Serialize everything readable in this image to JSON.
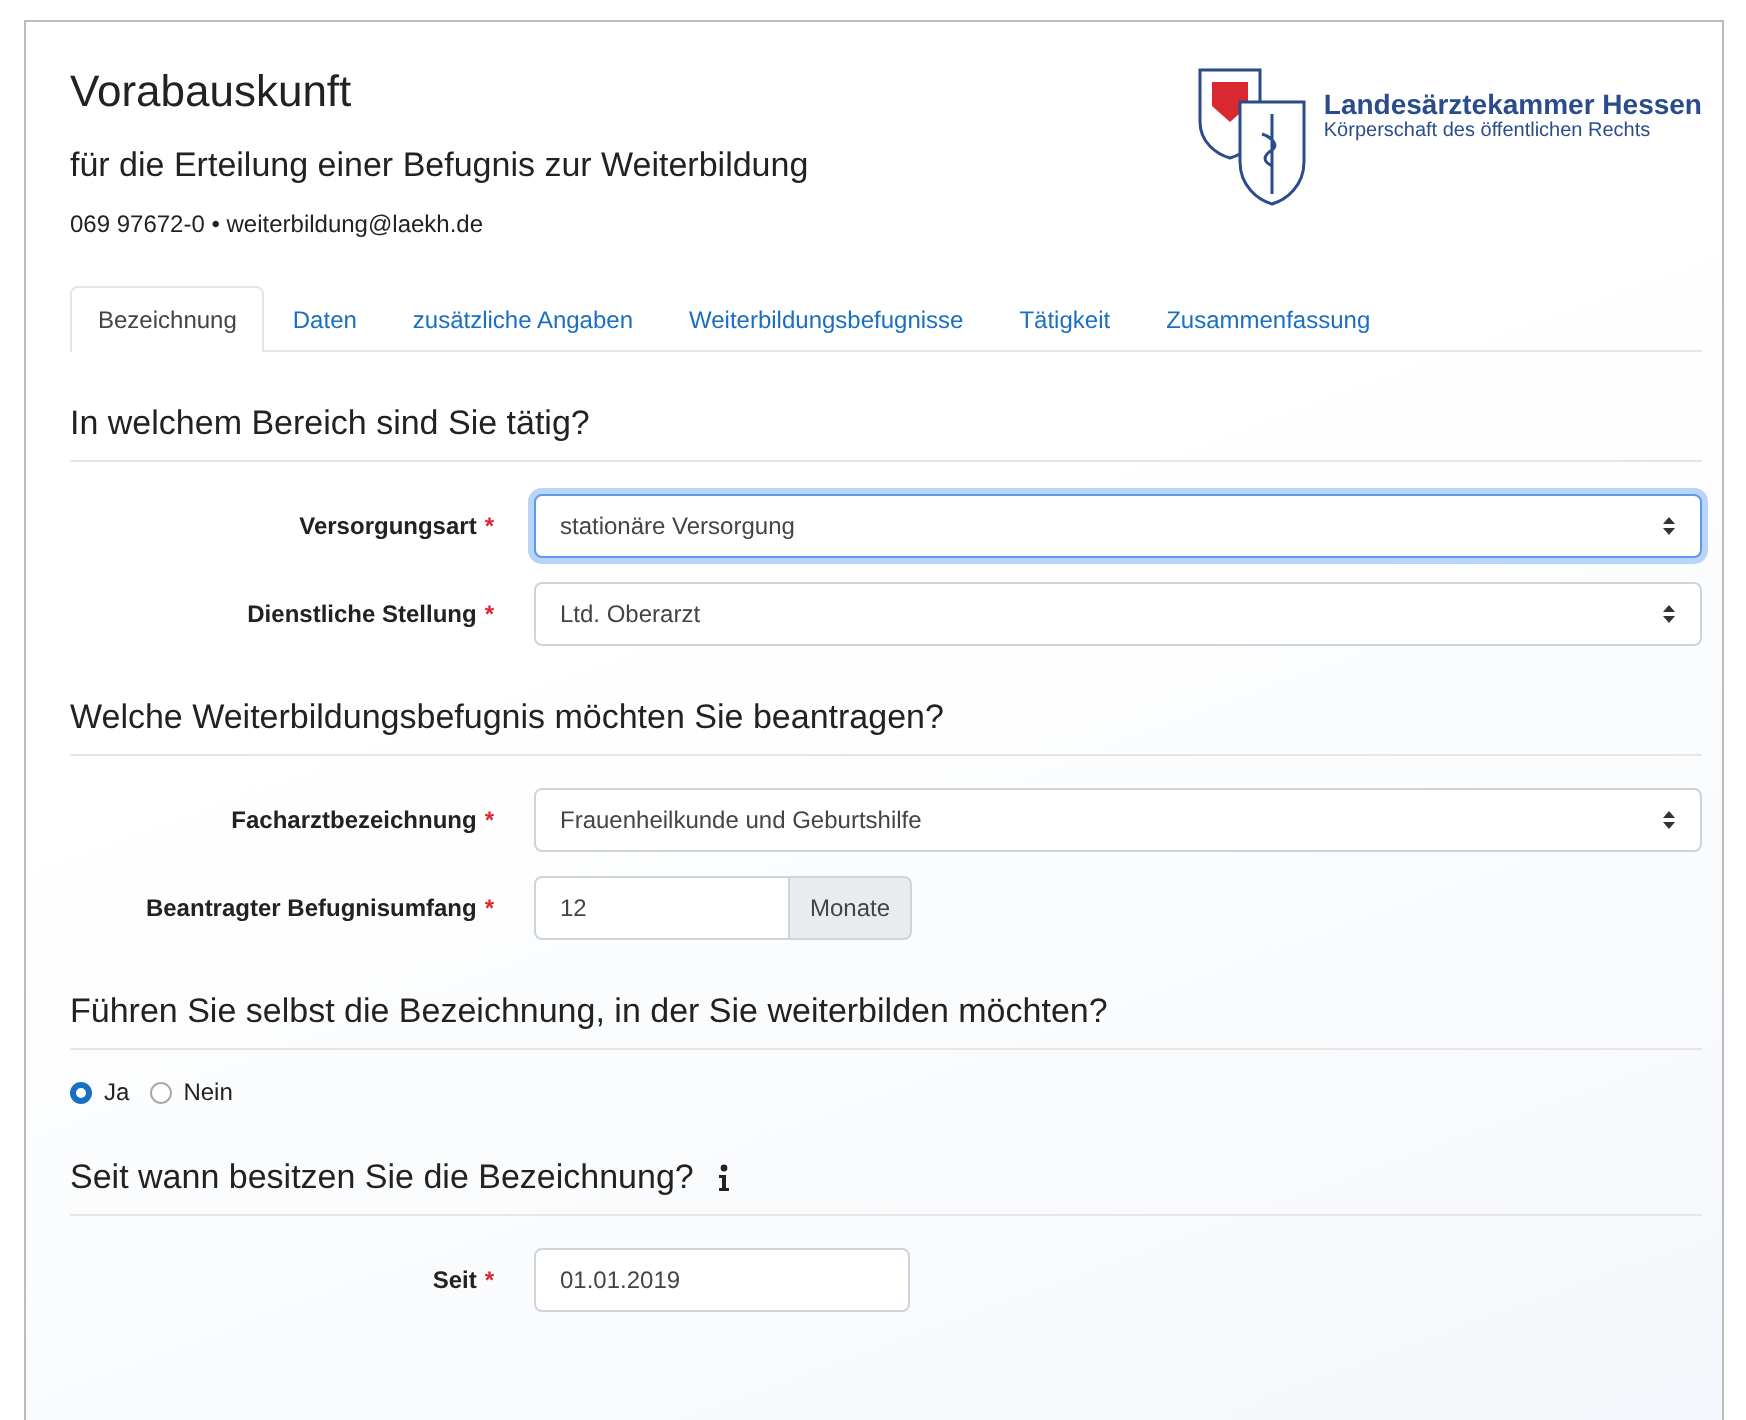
{
  "header": {
    "title": "Vorabauskunft",
    "subtitle": "für die Erteilung einer Befugnis zur Weiterbildung",
    "contact": "069 97672-0 • weiterbildung@laekh.de"
  },
  "logo": {
    "name": "Landesärztekammer Hessen",
    "tagline": "Körperschaft des öffentlichen Rechts"
  },
  "tabs": [
    {
      "label": "Bezeichnung",
      "selected": true
    },
    {
      "label": "Daten",
      "selected": false
    },
    {
      "label": "zusätzliche Angaben",
      "selected": false
    },
    {
      "label": "Weiterbildungsbefugnisse",
      "selected": false
    },
    {
      "label": "Tätigkeit",
      "selected": false
    },
    {
      "label": "Zusammenfassung",
      "selected": false
    }
  ],
  "sections": [
    {
      "heading": "In welchem Bereich sind Sie tätig?",
      "fields": [
        {
          "kind": "select",
          "label": "Versorgungsart",
          "mark": "*",
          "value": "stationäre Versorgung",
          "focused": true
        },
        {
          "kind": "select",
          "label": "Dienstliche Stellung",
          "mark": "*",
          "value": "Ltd. Oberarzt",
          "focused": false
        }
      ]
    },
    {
      "heading": "Welche Weiterbildungsbefugnis möchten Sie beantragen?",
      "fields": [
        {
          "kind": "select",
          "label": "Facharztbezeichnung",
          "mark": "*",
          "value": "Frauenheilkunde und Geburtshilfe",
          "focused": false
        },
        {
          "kind": "addon",
          "label": "Beantragter Befugnisumfang",
          "mark": "*",
          "value": "12",
          "addon": "Monate",
          "focused": false
        }
      ]
    },
    {
      "heading": "Führen Sie selbst die Bezeichnung, in der Sie weiterbilden möchten?",
      "radios": [
        {
          "label": "Ja",
          "selected": true
        },
        {
          "label": "Nein",
          "selected": false
        }
      ]
    },
    {
      "heading": "Seit wann besitzen Sie die Bezeichnung?",
      "info": true,
      "fields": [
        {
          "kind": "text",
          "label": "Seit",
          "mark": "*",
          "value": "01.01.2019",
          "focused": false
        }
      ]
    }
  ]
}
